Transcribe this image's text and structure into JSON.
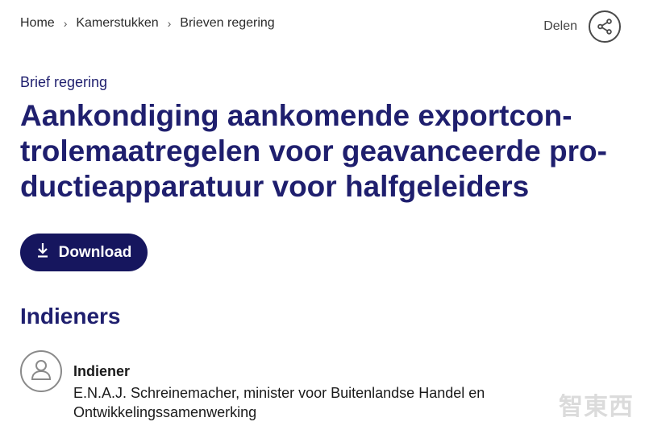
{
  "breadcrumb": {
    "items": [
      "Home",
      "Kamerstukken",
      "Brieven regering"
    ],
    "separator": "›"
  },
  "share": {
    "label": "Delen",
    "icon": "share-icon"
  },
  "document": {
    "type": "Brief regering",
    "title_lines": [
      "Aankondiging aankomende exportcon-",
      "trolemaatregelen voor geavanceerde pro-",
      "ductieapparatuur voor halfgeleiders"
    ],
    "download_label": "Download"
  },
  "indieners": {
    "heading": "Indieners",
    "role": "Indiener",
    "name_lines": [
      "E.N.A.J. Schreinemacher, minister voor Buitenlandse Handel en",
      "Ontwikkelingssamenwerking"
    ]
  },
  "watermark": "智東西",
  "colors": {
    "primary": "#1f1f6e",
    "button_bg": "#16165e",
    "text": "#1a1a1a"
  }
}
